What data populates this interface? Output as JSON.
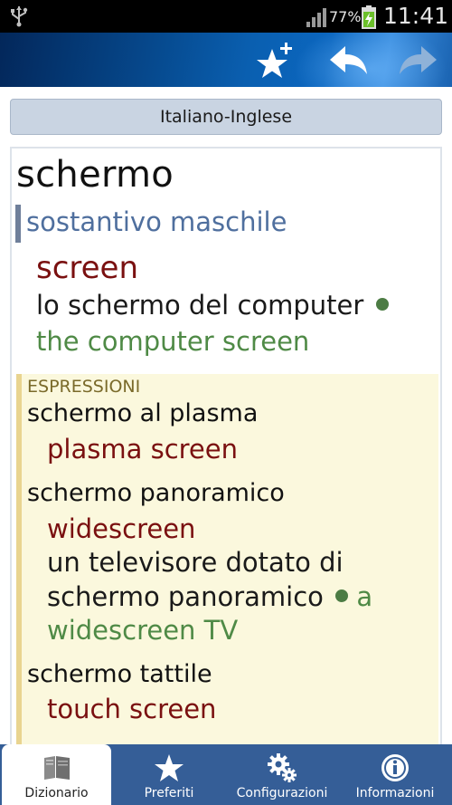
{
  "status": {
    "battery_percent": "77%",
    "time": "11:41",
    "icons": [
      "usb-icon",
      "signal-icon",
      "battery-charging-icon"
    ]
  },
  "actionbar": {
    "icons": [
      "star-plus-icon",
      "back-arrow-icon",
      "forward-arrow-icon"
    ]
  },
  "dictionary": {
    "selector": "Italiano-Inglese"
  },
  "entry": {
    "headword": "schermo",
    "part_of_speech": "sostantivo maschile",
    "translation": "screen",
    "example": "lo schermo del computer",
    "example_translation": "the computer screen"
  },
  "expressions": {
    "title": "ESPRESSIONI",
    "items": [
      {
        "phrase": "schermo al plasma",
        "translation": "plasma screen"
      },
      {
        "phrase": "schermo panoramico",
        "translation": "widescreen",
        "example_line1": "un televisore dotato di",
        "example_line2": "schermo panoramico",
        "example_translation_part1": "a",
        "example_translation_part2": "widescreen TV"
      },
      {
        "phrase": "schermo tattile",
        "translation": "touch screen"
      }
    ]
  },
  "tabs": [
    {
      "label": "Dizionario",
      "icon": "dictionary-book-icon",
      "selected": true
    },
    {
      "label": "Preferiti",
      "icon": "star-icon",
      "selected": false
    },
    {
      "label": "Configurazioni",
      "icon": "gears-icon",
      "selected": false
    },
    {
      "label": "Informazioni",
      "icon": "info-icon",
      "selected": false
    }
  ],
  "colors": {
    "actionbar": "#0a5fb0",
    "tabbar": "#355e97",
    "translation": "#7a1010",
    "example_translation": "#4f8a46",
    "part_of_speech": "#4f6f9e",
    "expressions_background": "#fbf8dd"
  }
}
